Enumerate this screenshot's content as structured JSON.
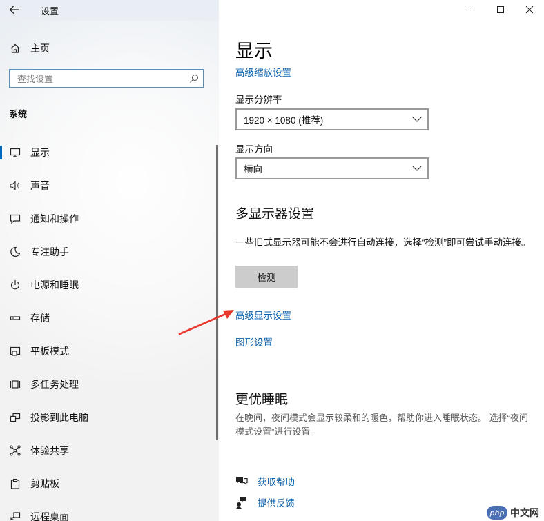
{
  "window": {
    "title": "设置",
    "controls": {
      "minimize": "minimize-icon",
      "maximize": "maximize-icon",
      "close": "close-icon"
    }
  },
  "sidebar": {
    "home_label": "主页",
    "search_placeholder": "查找设置",
    "group_label": "系统",
    "items": [
      {
        "label": "显示",
        "icon": "monitor-icon",
        "active": true
      },
      {
        "label": "声音",
        "icon": "speaker-icon"
      },
      {
        "label": "通知和操作",
        "icon": "notification-icon"
      },
      {
        "label": "专注助手",
        "icon": "moon-icon"
      },
      {
        "label": "电源和睡眠",
        "icon": "power-icon"
      },
      {
        "label": "存储",
        "icon": "storage-icon"
      },
      {
        "label": "平板模式",
        "icon": "tablet-icon"
      },
      {
        "label": "多任务处理",
        "icon": "multitask-icon"
      },
      {
        "label": "投影到此电脑",
        "icon": "project-icon"
      },
      {
        "label": "体验共享",
        "icon": "share-icon"
      },
      {
        "label": "剪贴板",
        "icon": "clipboard-icon"
      },
      {
        "label": "远程桌面",
        "icon": "remote-desktop-icon"
      }
    ]
  },
  "main": {
    "title": "显示",
    "advanced_scaling_link": "高级缩放设置",
    "resolution_label": "显示分辨率",
    "resolution_value": "1920 × 1080 (推荐)",
    "orientation_label": "显示方向",
    "orientation_value": "横向",
    "multi_display_heading": "多显示器设置",
    "multi_display_desc": "一些旧式显示器可能不会进行自动连接，选择“检测”即可尝试手动连接。",
    "detect_button": "检测",
    "advanced_display_link": "高级显示设置",
    "graphics_link": "图形设置",
    "sleep_heading": "更优睡眠",
    "sleep_desc": "在晚间，夜间模式会显示较柔和的暖色，帮助你进入睡眠状态。 选择“夜间模式设置”进行设置。",
    "get_help": "获取帮助",
    "feedback": "提供反馈"
  },
  "watermark": {
    "badge": "php",
    "text": "中文网"
  },
  "colors": {
    "accent": "#0067b8",
    "link": "#0b5fa8",
    "arrow": "#e8372c"
  }
}
